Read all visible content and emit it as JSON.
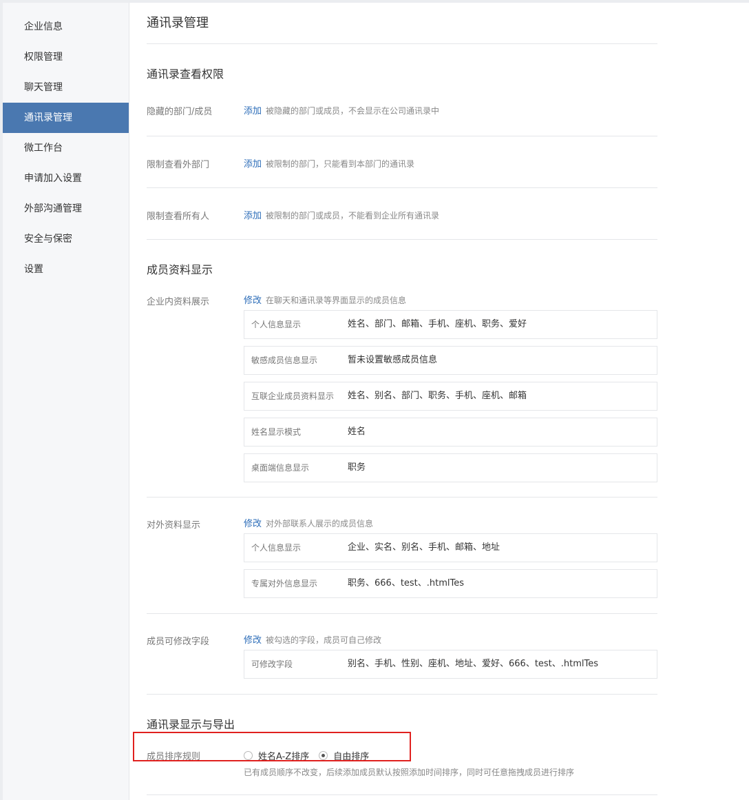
{
  "sidebar": {
    "items": [
      {
        "label": "企业信息"
      },
      {
        "label": "权限管理"
      },
      {
        "label": "聊天管理"
      },
      {
        "label": "通讯录管理"
      },
      {
        "label": "微工作台"
      },
      {
        "label": "申请加入设置"
      },
      {
        "label": "外部沟通管理"
      },
      {
        "label": "安全与保密"
      },
      {
        "label": "设置"
      }
    ],
    "active_index": 3
  },
  "page_title": "通讯录管理",
  "section_view": {
    "title": "通讯录查看权限",
    "rows": [
      {
        "label": "隐藏的部门/成员",
        "action": "添加",
        "desc": "被隐藏的部门或成员，不会显示在公司通讯录中"
      },
      {
        "label": "限制查看外部门",
        "action": "添加",
        "desc": "被限制的部门，只能看到本部门的通讯录"
      },
      {
        "label": "限制查看所有人",
        "action": "添加",
        "desc": "被限制的部门或成员，不能看到企业所有通讯录"
      }
    ]
  },
  "section_profile": {
    "title": "成员资料显示",
    "internal": {
      "label": "企业内资料展示",
      "action": "修改",
      "desc": "在聊天和通讯录等界面显示的成员信息",
      "items": [
        {
          "key": "个人信息显示",
          "value": "姓名、部门、邮箱、手机、座机、职务、爱好"
        },
        {
          "key": "敏感成员信息显示",
          "value": "暂未设置敏感成员信息"
        },
        {
          "key": "互联企业成员资料显示",
          "value": "姓名、别名、部门、职务、手机、座机、邮箱"
        },
        {
          "key": "姓名显示模式",
          "value": "姓名"
        },
        {
          "key": "桌面端信息显示",
          "value": "职务"
        }
      ]
    },
    "external": {
      "label": "对外资料显示",
      "action": "修改",
      "desc": "对外部联系人展示的成员信息",
      "items": [
        {
          "key": "个人信息显示",
          "value": "企业、实名、别名、手机、邮箱、地址"
        },
        {
          "key": "专属对外信息显示",
          "value": "职务、666、test、.htmlTes"
        }
      ]
    },
    "editable": {
      "label": "成员可修改字段",
      "action": "修改",
      "desc": "被勾选的字段，成员可自己修改",
      "items": [
        {
          "key": "可修改字段",
          "value": "别名、手机、性别、座机、地址、爱好、666、test、.htmlTes"
        }
      ]
    }
  },
  "section_export": {
    "title": "通讯录显示与导出",
    "sort": {
      "label": "成员排序规则",
      "options": [
        {
          "label": "姓名A-Z排序",
          "checked": false
        },
        {
          "label": "自由排序",
          "checked": true
        }
      ],
      "hint": "已有成员顺序不改变，后续添加成员默认按照添加时间排序，同时可任意拖拽成员进行排序"
    }
  },
  "colors": {
    "sidebar_active": "#4a78b0",
    "link": "#2b6cb8",
    "highlight_border": "#e0201e"
  }
}
